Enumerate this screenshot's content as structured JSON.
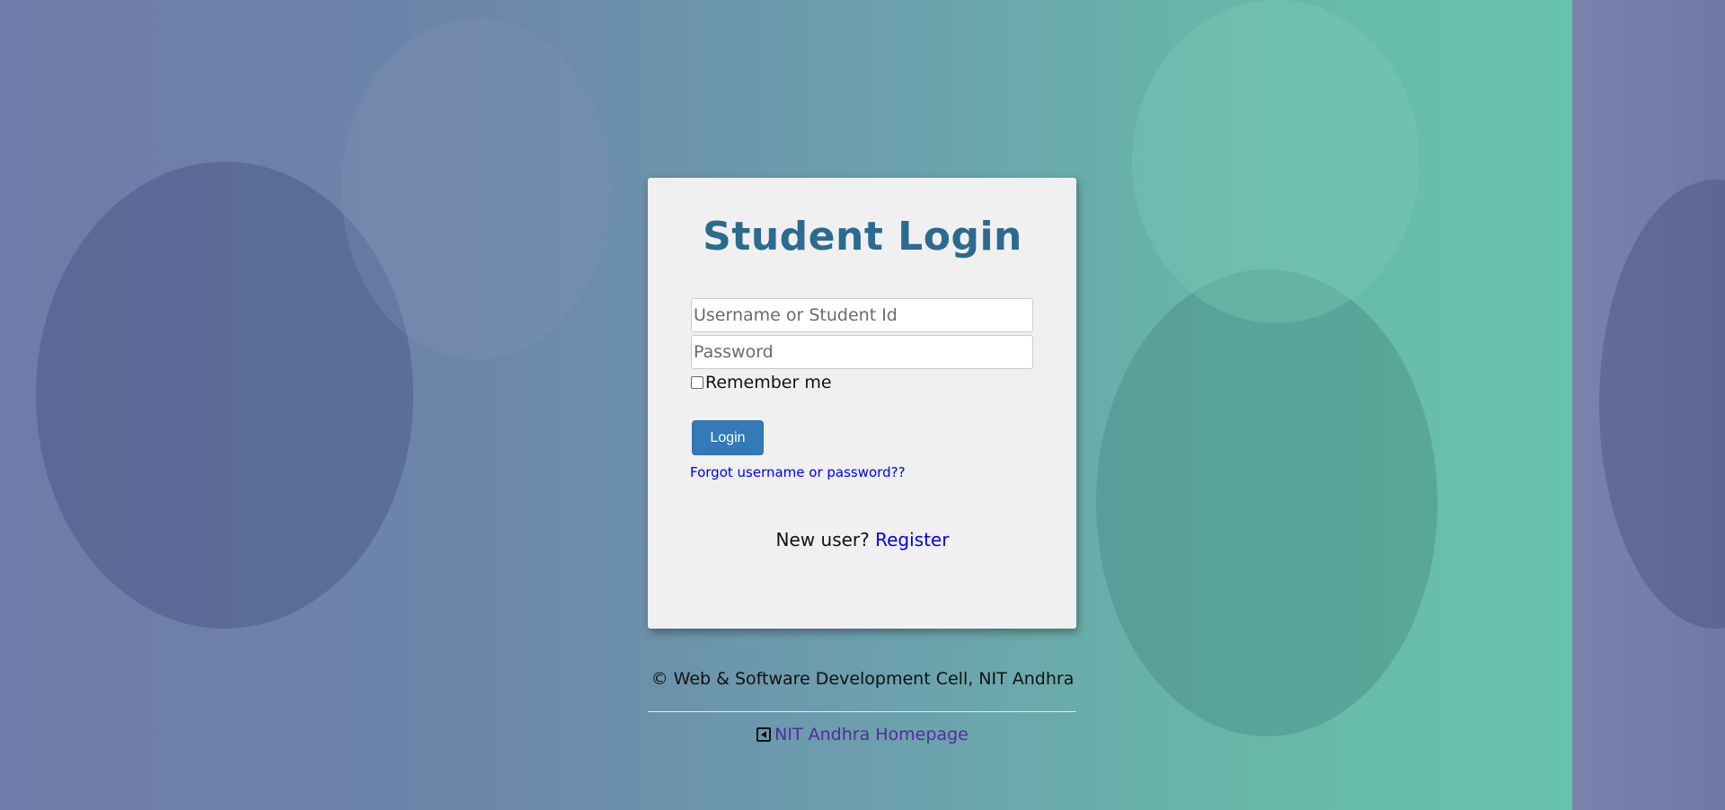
{
  "page": {
    "title": "Student Login"
  },
  "form": {
    "username_placeholder": "Username or Student Id",
    "username_value": "",
    "password_placeholder": "Password",
    "password_value": "",
    "remember_label": "Remember me",
    "remember_checked": false,
    "login_label": "Login",
    "forgot_label": "Forgot username or password??"
  },
  "register": {
    "prompt": "New user?",
    "link_label": "Register"
  },
  "footer": {
    "copyright": "© Web & Software Development Cell, NIT Andhra",
    "homepage_label": "NIT Andhra Homepage",
    "homepage_icon": "arrow-square-left-icon"
  },
  "colors": {
    "title": "#2c6a90",
    "login_button": "#337ab7",
    "link": "#0000ee",
    "homepage_link": "#55299c",
    "card_bg": "#f0f0f0"
  }
}
